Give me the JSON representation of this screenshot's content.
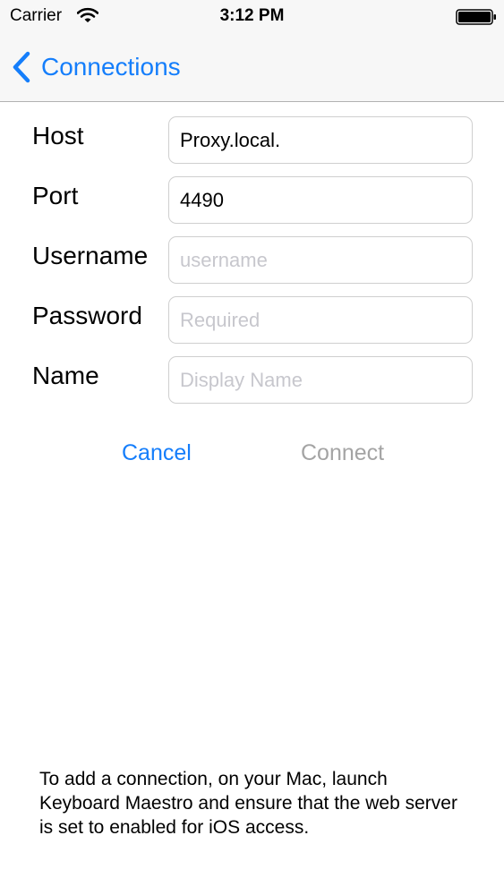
{
  "status_bar": {
    "carrier": "Carrier",
    "time": "3:12 PM",
    "wifi_icon": "wifi-icon",
    "battery_icon": "battery-icon"
  },
  "nav": {
    "back_label": "Connections",
    "back_icon": "chevron-left-icon"
  },
  "form": {
    "fields": [
      {
        "label": "Host",
        "value": "Proxy.local.",
        "placeholder": ""
      },
      {
        "label": "Port",
        "value": "4490",
        "placeholder": ""
      },
      {
        "label": "Username",
        "value": "",
        "placeholder": "username"
      },
      {
        "label": "Password",
        "value": "",
        "placeholder": "Required"
      },
      {
        "label": "Name",
        "value": "",
        "placeholder": "Display Name"
      }
    ]
  },
  "actions": {
    "cancel_label": "Cancel",
    "connect_label": "Connect"
  },
  "footer": {
    "text": "To add a connection, on your Mac, launch Keyboard Maestro and ensure that the web server is set to enabled for iOS access."
  },
  "colors": {
    "accent": "#157efb",
    "disabled": "#a4a4a4",
    "placeholder": "#c7c7cd",
    "bar_background": "#f7f7f7"
  }
}
